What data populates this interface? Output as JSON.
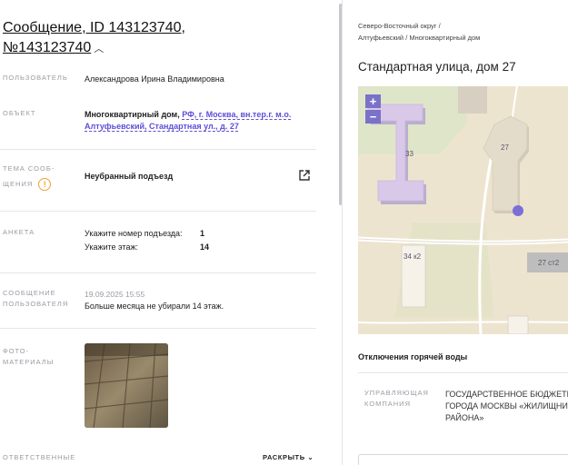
{
  "message": {
    "title_line1": "Сообщение, ID 143123740,",
    "title_line2": "№143123740",
    "chevron": "^"
  },
  "fields": {
    "user_label": "ПОЛЬЗОВАТЕЛЬ",
    "user_value": "Александрова Ирина Владимировна",
    "object_label": "ОБЪЕКТ",
    "object_type": "Многоквартирный дом,",
    "object_address_line1": "РФ, г. Москва, вн.тер.г. м.о.",
    "object_address_line2": "Алтуфьевский, Стандартная ул., д. 27",
    "topic_label_line1": "ТЕМА СООБ-",
    "topic_label_line2": "ЩЕНИЯ",
    "topic_value": "Неубранный подъезд",
    "survey_label": "АНКЕТА",
    "survey": [
      {
        "question": "Укажите номер подъезда:",
        "answer": "1"
      },
      {
        "question": "Укажите этаж:",
        "answer": "14"
      }
    ],
    "user_message_label_line1": "СООБЩЕНИЕ",
    "user_message_label_line2": "ПОЛЬЗОВАТЕЛЯ",
    "user_message_date": "19.09.2025 15:55",
    "user_message_text": "Больше месяца не убирали 14 этаж.",
    "photo_label_line1": "ФОТО-",
    "photo_label_line2": "МАТЕРИАЛЫ",
    "responsible_label": "ОТВЕТСТВЕННЫЕ",
    "expand_label": "РАСКРЫТЬ",
    "expand_chevron": "⌄"
  },
  "right": {
    "breadcrumb_line1": "Северо-Восточный округ /",
    "breadcrumb_line2": "Алтуфьевский / Многоквартирный дом",
    "address_title": "Стандартная улица, дом 27",
    "map": {
      "zoom_in": "+",
      "zoom_out": "−",
      "buildings": [
        "33",
        "27",
        "34 к2",
        "27 ст2"
      ],
      "marker_color": "#7b6fd6"
    },
    "section_label": "Отключения горячей воды",
    "management_label_line1": "УПРАВЛЯЮЩАЯ",
    "management_label_line2": "КОМПАНИЯ",
    "management_value_line1": "ГОСУДАРСТВЕННОЕ БЮДЖЕТН",
    "management_value_line2": "ГОРОДА МОСКВЫ «ЖИЛИЩНИ",
    "management_value_line3": "РАЙОНА»"
  }
}
